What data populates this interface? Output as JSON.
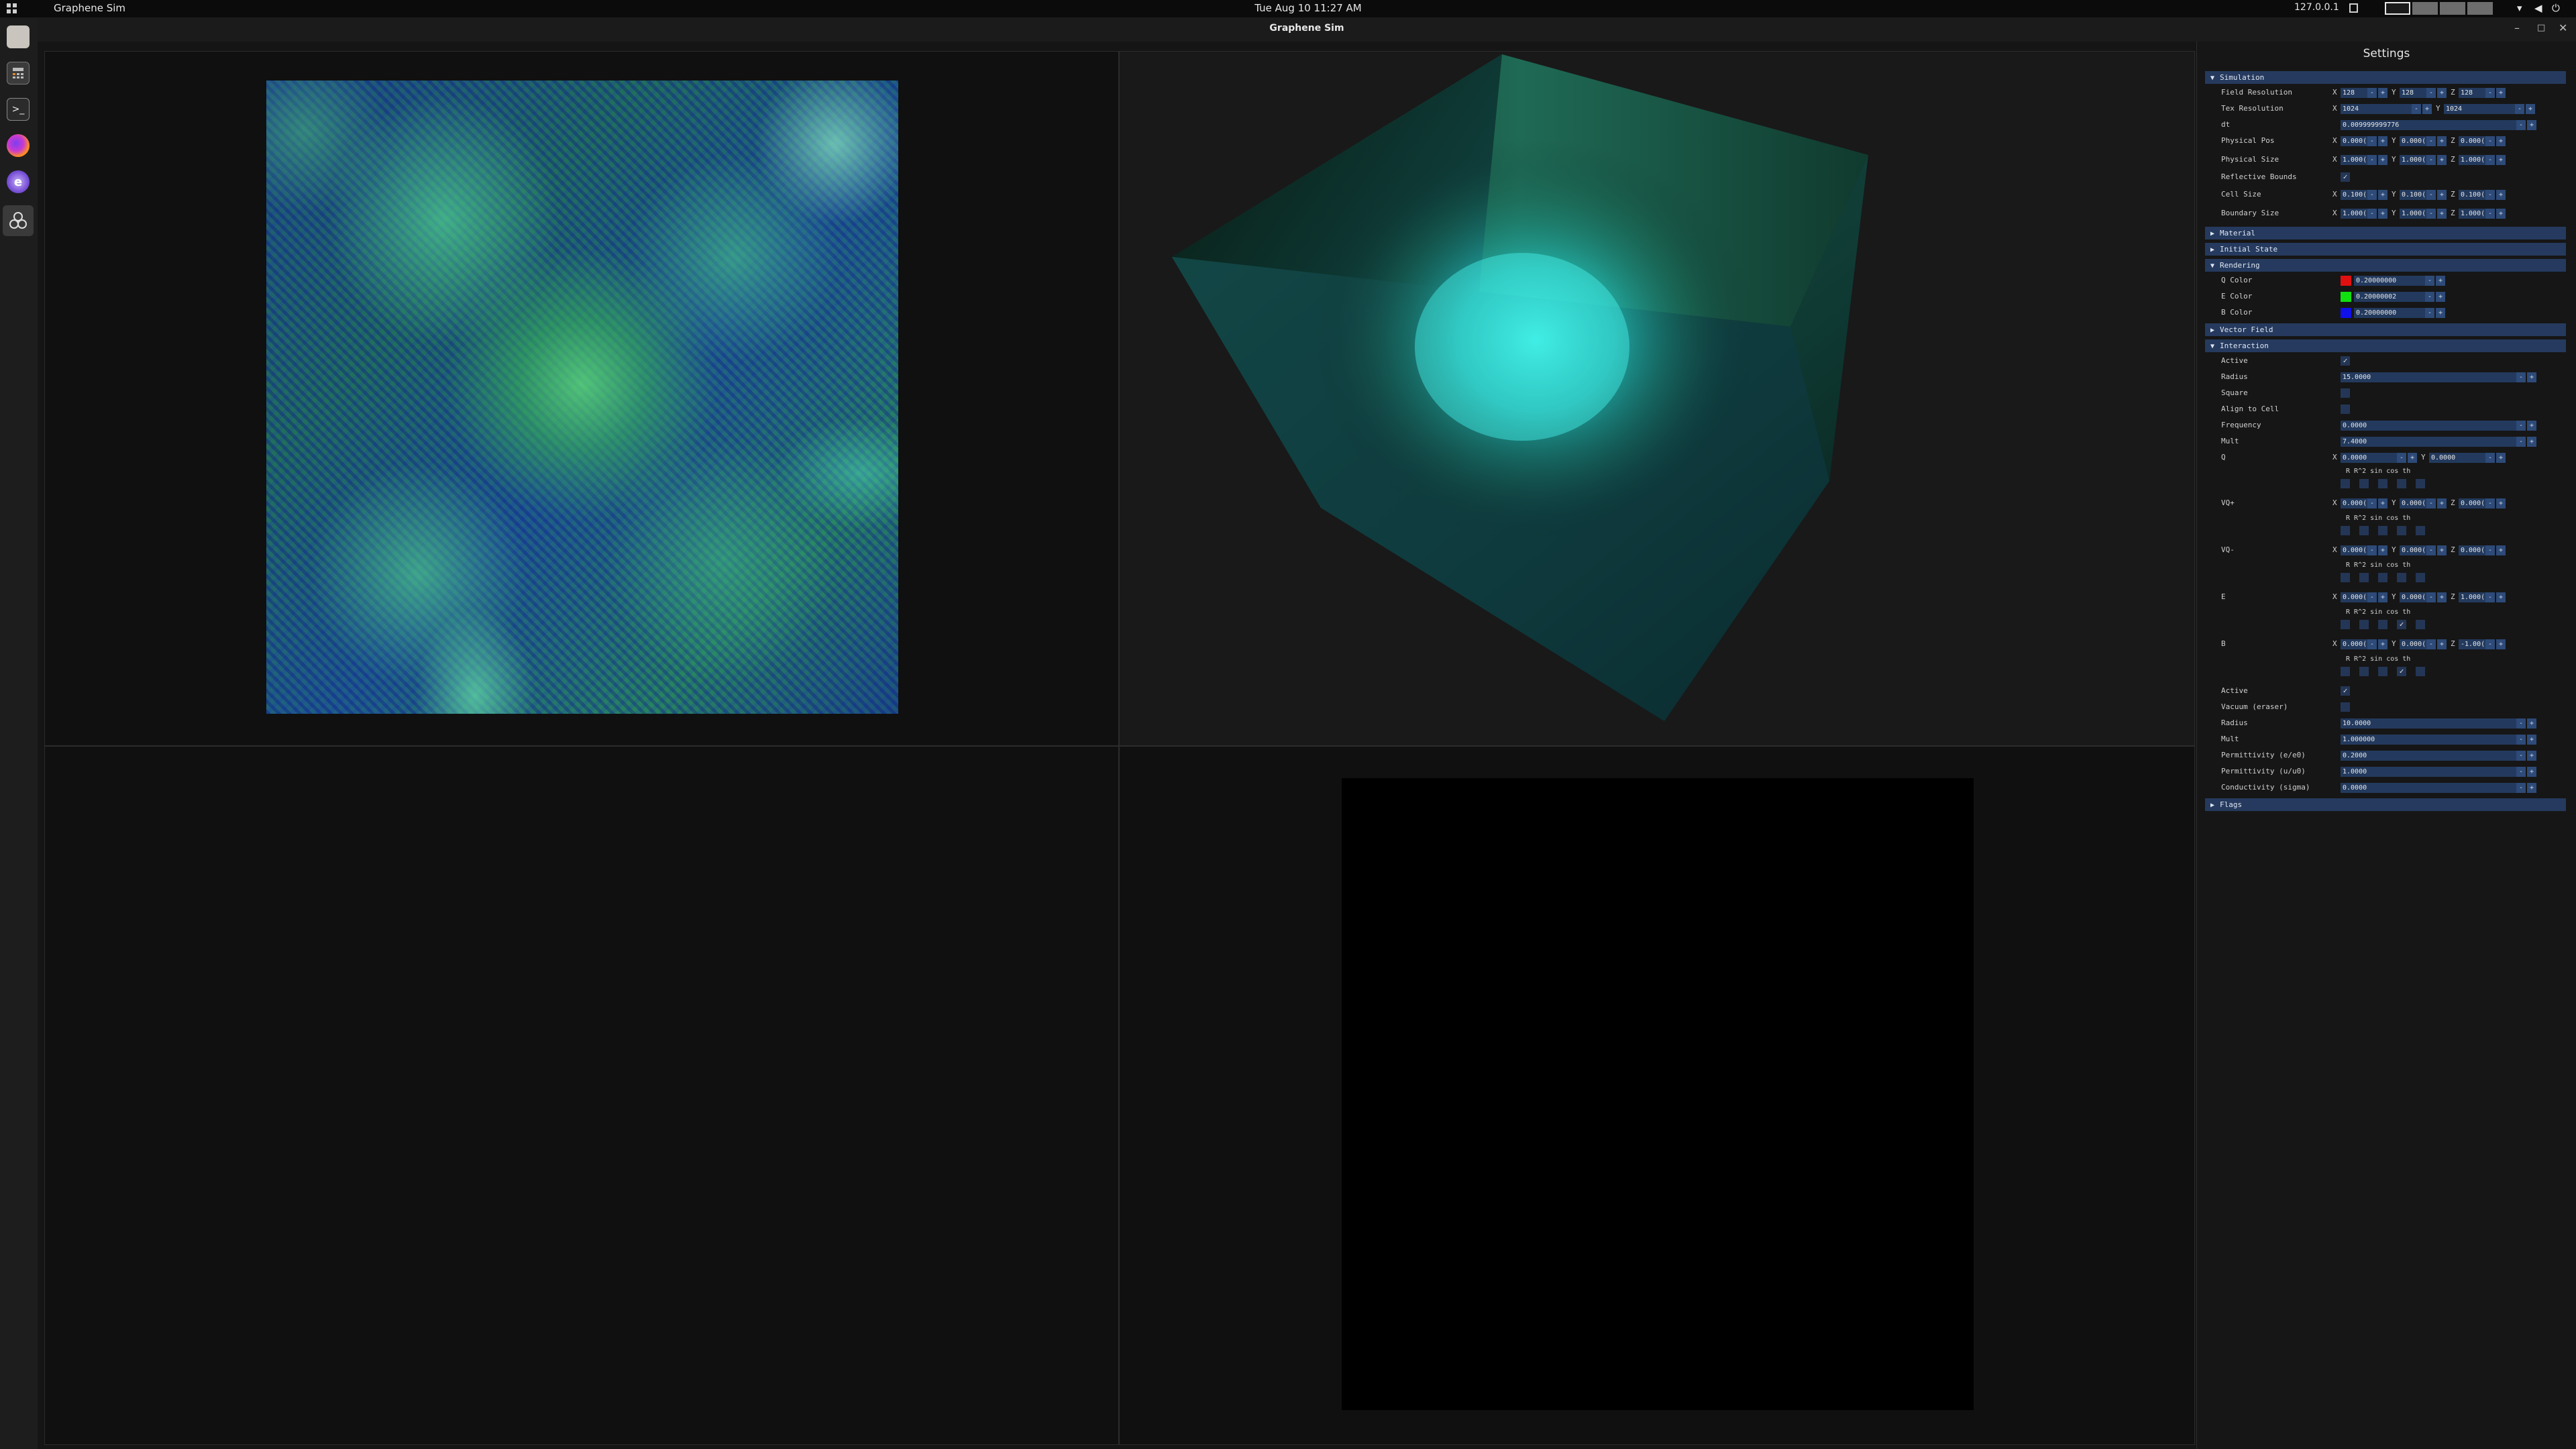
{
  "topbar": {
    "app_name": "Graphene Sim",
    "clock": "Tue Aug 10  11:27 AM",
    "ip": "127.0.0.1",
    "workspaces": 4
  },
  "dock": [
    "files-icon",
    "calculator-icon",
    "terminal-icon",
    "firefox-icon",
    "emacs-icon",
    "graphene-sim-icon"
  ],
  "window": {
    "title": "Graphene Sim"
  },
  "panel": {
    "title": "Settings",
    "colors": {
      "q": "#e01010",
      "e": "#10e010",
      "b": "#1010e8",
      "header": "#253a5e"
    },
    "simulation": {
      "header": "Simulation",
      "field_resolution": {
        "label": "Field Resolution",
        "x": "128",
        "y": "128",
        "z": "128"
      },
      "tex_resolution": {
        "label": "Tex Resolution",
        "x": "1024",
        "y": "1024"
      },
      "dt": {
        "label": "dt",
        "value": "0.009999999776"
      },
      "physical_pos": {
        "label": "Physical Pos",
        "x": "0.000(",
        "y": "0.000(",
        "z": "0.000("
      },
      "physical_size": {
        "label": "Physical Size",
        "x": "1.000(",
        "y": "1.000(",
        "z": "1.000("
      },
      "reflective_bounds": {
        "label": "Reflective Bounds",
        "checked": "✓"
      },
      "cell_size": {
        "label": "Cell Size",
        "x": "0.100(",
        "y": "0.100(",
        "z": "0.100("
      },
      "boundary_size": {
        "label": "Boundary Size",
        "x": "1.000(",
        "y": "1.000(",
        "z": "1.000("
      }
    },
    "material": {
      "header": "Material"
    },
    "initial_state": {
      "header": "Initial State"
    },
    "rendering": {
      "header": "Rendering",
      "q_color": {
        "label": "Q Color",
        "value": "0.20000000"
      },
      "e_color": {
        "label": "E Color",
        "value": "0.20000002"
      },
      "b_color": {
        "label": "B Color",
        "value": "0.20000000"
      }
    },
    "vector_field": {
      "header": "Vector Field"
    },
    "interaction": {
      "header": "Interaction",
      "active": {
        "label": "Active",
        "checked": "✓"
      },
      "radius": {
        "label": "Radius",
        "value": "15.0000"
      },
      "square": {
        "label": "Square"
      },
      "align_to_cell": {
        "label": "Align to Cell"
      },
      "frequency": {
        "label": "Frequency",
        "value": "0.0000"
      },
      "mult": {
        "label": "Mult",
        "value": "7.4000"
      },
      "sub_labels": "R  R^2 sin cos th",
      "q": {
        "label": "Q",
        "x": "0.0000",
        "y": "0.0000"
      },
      "vq_plus": {
        "label": "VQ+",
        "x": "0.000(",
        "y": "0.000(",
        "z": "0.000("
      },
      "vq_minus": {
        "label": "VQ-",
        "x": "0.000(",
        "y": "0.000(",
        "z": "0.000("
      },
      "e": {
        "label": "E",
        "x": "0.000(",
        "y": "0.000(",
        "z": "1.000("
      },
      "b": {
        "label": "B",
        "x": "0.000(",
        "y": "0.000(",
        "z": "-1.00("
      },
      "active2": {
        "label": "Active",
        "checked": "✓"
      },
      "vacuum": {
        "label": "Vacuum (eraser)"
      },
      "radius2": {
        "label": "Radius",
        "value": "10.0000"
      },
      "mult2": {
        "label": "Mult",
        "value": "1.000000"
      },
      "permittivity": {
        "label": "Permittivity (e/e0)",
        "value": "0.2000"
      },
      "permeability": {
        "label": "Permittivity (u/u0)",
        "value": "1.0000"
      },
      "conductivity": {
        "label": "Conductivity (sigma)",
        "value": "0.0000"
      }
    },
    "flags": {
      "header": "Flags"
    },
    "axes": {
      "x": "X",
      "y": "Y",
      "z": "Z"
    },
    "stepper": {
      "minus": "-",
      "plus": "+"
    },
    "arrows": {
      "open": "▼",
      "closed": "▶"
    }
  }
}
